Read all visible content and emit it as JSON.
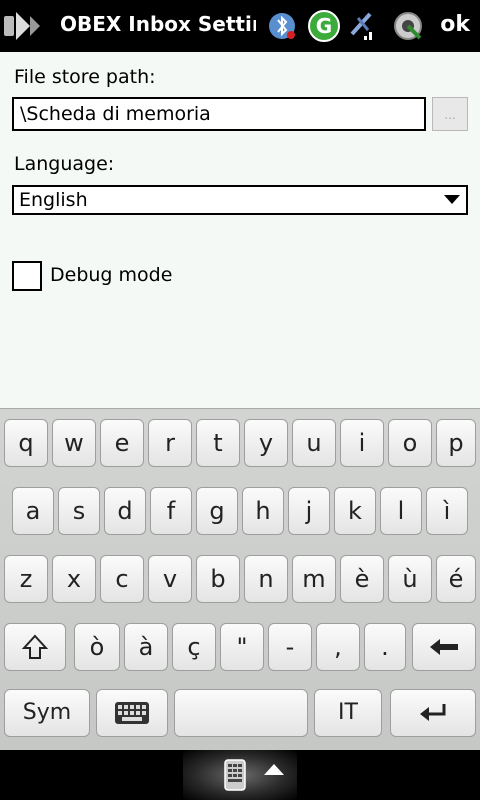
{
  "titlebar": {
    "title": "OBEX Inbox Settings",
    "ok_label": "ok",
    "icons": [
      "windows-start-icon",
      "bluetooth-icon",
      "g-app-icon",
      "signal-icon",
      "sync-icon"
    ]
  },
  "form": {
    "file_store_label": "File store path:",
    "file_store_value": "\\Scheda di memoria",
    "browse_label": "...",
    "language_label": "Language:",
    "language_value": "English",
    "debug_label": "Debug mode",
    "debug_checked": false
  },
  "keyboard": {
    "row1": [
      "q",
      "w",
      "e",
      "r",
      "t",
      "y",
      "u",
      "i",
      "o",
      "p"
    ],
    "row2": [
      "a",
      "s",
      "d",
      "f",
      "g",
      "h",
      "j",
      "k",
      "l",
      "ì"
    ],
    "row3": [
      "z",
      "x",
      "c",
      "v",
      "b",
      "n",
      "m",
      "è",
      "ù",
      "é"
    ],
    "row4": [
      "ò",
      "à",
      "ç",
      "\"",
      "-",
      ",",
      "."
    ],
    "sym_label": "Sym",
    "lang_label": "IT"
  },
  "colors": {
    "accent_green": "#3cab3c",
    "content_bg": "#f5f9f5"
  }
}
